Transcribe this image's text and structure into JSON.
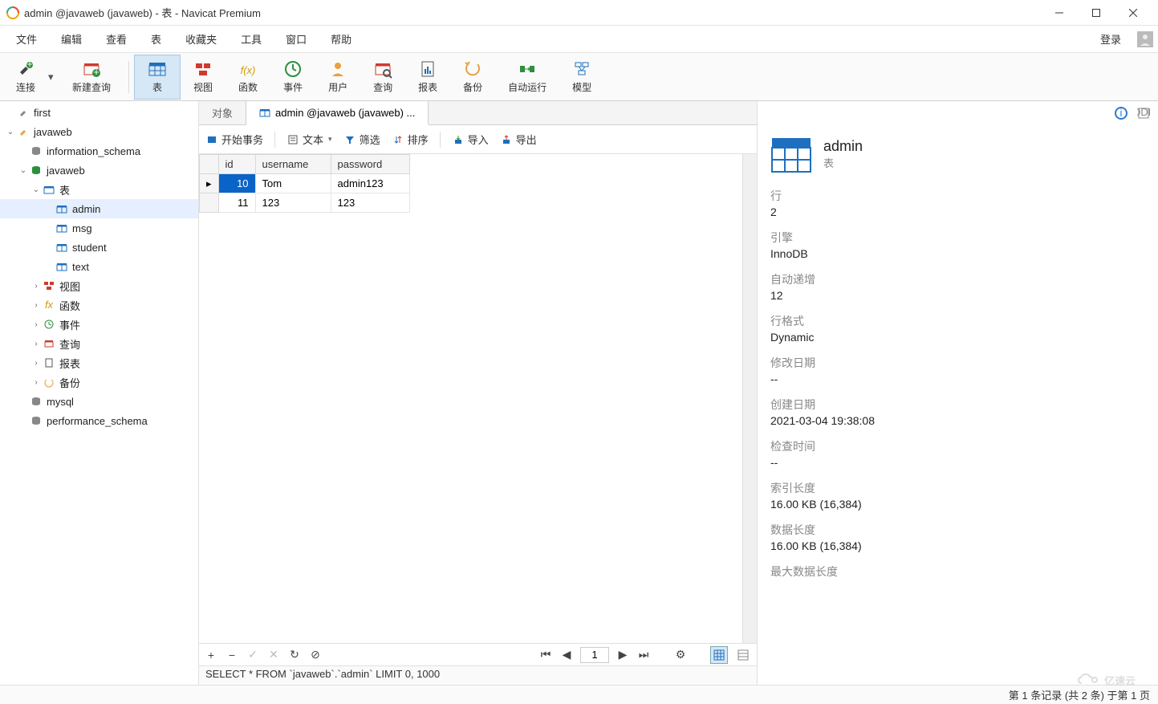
{
  "window": {
    "title": "admin @javaweb (javaweb) - 表 - Navicat Premium"
  },
  "menu": {
    "items": [
      "文件",
      "编辑",
      "查看",
      "表",
      "收藏夹",
      "工具",
      "窗口",
      "帮助"
    ],
    "login": "登录"
  },
  "toolbar": {
    "connect": "连接",
    "new_query": "新建查询",
    "table": "表",
    "view": "视图",
    "function": "函数",
    "event": "事件",
    "user": "用户",
    "query": "查询",
    "report": "报表",
    "backup": "备份",
    "autorun": "自动运行",
    "model": "模型"
  },
  "tree": {
    "first": "first",
    "javaweb_conn": "javaweb",
    "information_schema": "information_schema",
    "javaweb_db": "javaweb",
    "tables": "表",
    "admin": "admin",
    "msg": "msg",
    "student": "student",
    "text": "text",
    "views": "视图",
    "functions": "函数",
    "events": "事件",
    "queries": "查询",
    "reports": "报表",
    "backups": "备份",
    "mysql": "mysql",
    "performance_schema": "performance_schema"
  },
  "tabs": {
    "objects": "对象",
    "admin_tab": "admin @javaweb (javaweb) ..."
  },
  "subtoolbar": {
    "begin_txn": "开始事务",
    "text": "文本",
    "filter": "筛选",
    "sort": "排序",
    "import": "导入",
    "export": "导出"
  },
  "grid": {
    "columns": [
      "id",
      "username",
      "password"
    ],
    "rows": [
      {
        "id": "10",
        "username": "Tom",
        "password": "admin123"
      },
      {
        "id": "11",
        "username": "123",
        "password": "123"
      }
    ]
  },
  "pager": {
    "page": "1"
  },
  "sql": "SELECT * FROM `javaweb`.`admin` LIMIT 0, 1000",
  "info": {
    "title": "admin",
    "subtitle": "表",
    "rows_label": "行",
    "rows_value": "2",
    "engine_label": "引擎",
    "engine_value": "InnoDB",
    "autoinc_label": "自动递增",
    "autoinc_value": "12",
    "rowfmt_label": "行格式",
    "rowfmt_value": "Dynamic",
    "mod_label": "修改日期",
    "mod_value": "--",
    "create_label": "创建日期",
    "create_value": "2021-03-04 19:38:08",
    "check_label": "检查时间",
    "check_value": "--",
    "idxlen_label": "索引长度",
    "idxlen_value": "16.00 KB (16,384)",
    "datalen_label": "数据长度",
    "datalen_value": "16.00 KB (16,384)",
    "maxlen_label": "最大数据长度"
  },
  "status": {
    "text": "第 1 条记录 (共 2 条) 于第 1 页"
  },
  "watermark": {
    "brand": "亿速云"
  }
}
